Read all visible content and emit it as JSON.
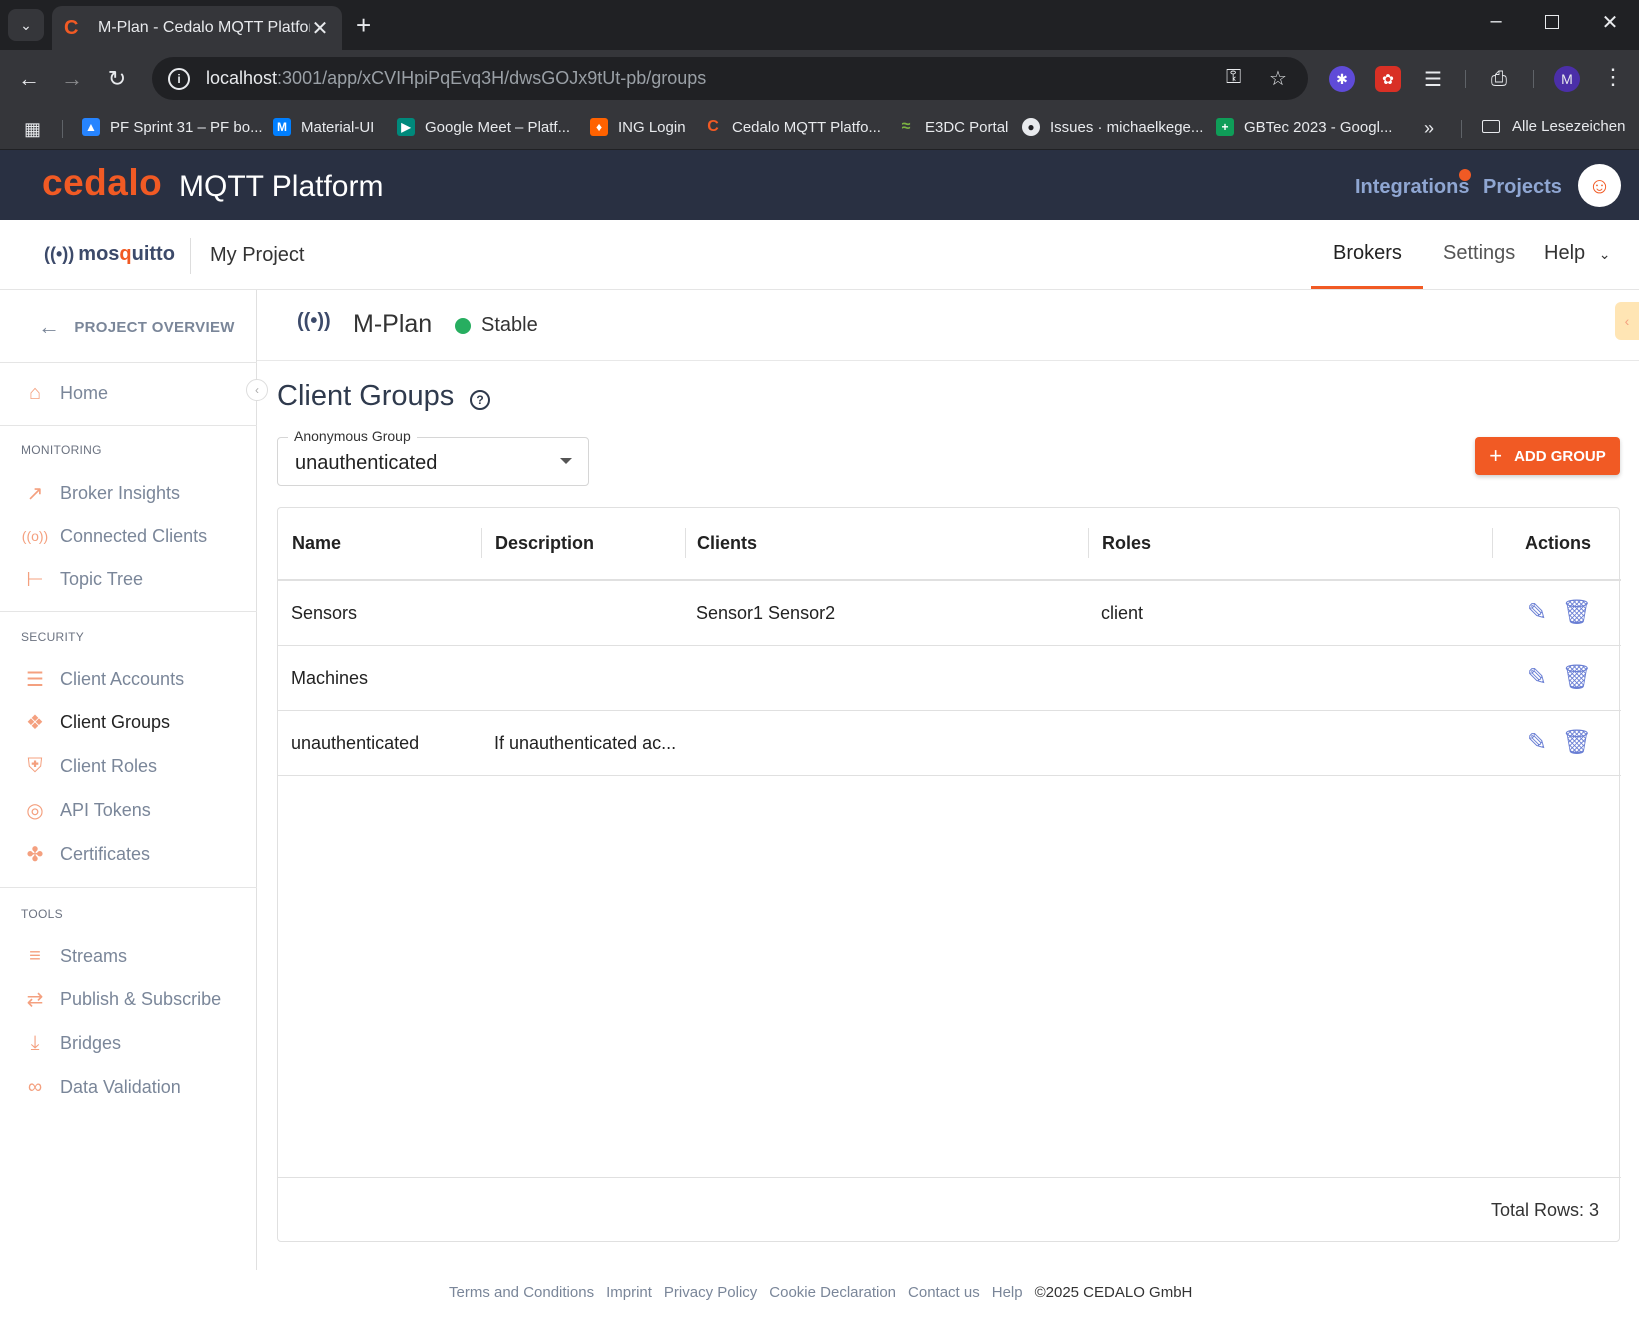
{
  "browser": {
    "tab_title": "M-Plan - Cedalo MQTT Platform",
    "url_host": "localhost",
    "url_rest": ":3001/app/xCVIHpiPqEvq3H/dwsGOJx9tUt-pb/groups",
    "bookmarks": [
      {
        "label": "PF Sprint 31 – PF bo...",
        "color": "#2684ff"
      },
      {
        "label": "Material-UI",
        "color": "#007fff"
      },
      {
        "label": "Google Meet – Platf...",
        "color": "#00897b"
      },
      {
        "label": "ING Login",
        "color": "#ff6200"
      },
      {
        "label": "Cedalo MQTT Platfo...",
        "color": "#f15a24"
      },
      {
        "label": "E3DC Portal",
        "color": "#7cb342"
      },
      {
        "label": "Issues · michaelkege...",
        "color": "#202124"
      },
      {
        "label": "GBTec 2023 - Googl...",
        "color": "#0f9d58"
      }
    ],
    "all_bookmarks": "Alle Lesezeichen",
    "profile_initial": "M"
  },
  "header": {
    "brand": "cedalo",
    "product": "MQTT Platform",
    "integrations": "Integrations",
    "projects": "Projects"
  },
  "subheader": {
    "logo_text_a": "mos",
    "logo_text_b": "q",
    "logo_text_c": "uitto",
    "project": "My Project",
    "tabs": [
      "Brokers",
      "Settings",
      "Help"
    ]
  },
  "sidebar": {
    "project_overview": "PROJECT OVERVIEW",
    "home": "Home",
    "sections": {
      "monitoring": "MONITORING",
      "security": "SECURITY",
      "tools": "TOOLS"
    },
    "monitoring": [
      "Broker Insights",
      "Connected Clients",
      "Topic Tree"
    ],
    "security": [
      "Client Accounts",
      "Client Groups",
      "Client Roles",
      "API Tokens",
      "Certificates"
    ],
    "tools": [
      "Streams",
      "Publish & Subscribe",
      "Bridges",
      "Data Validation"
    ]
  },
  "broker": {
    "name": "M-Plan",
    "status": "Stable",
    "status_color": "#27ae60"
  },
  "main": {
    "title": "Client Groups",
    "anonymous_label": "Anonymous Group",
    "anonymous_value": "unauthenticated",
    "add_button": "ADD GROUP",
    "columns": [
      "Name",
      "Description",
      "Clients",
      "Roles",
      "Actions"
    ],
    "rows": [
      {
        "name": "Sensors",
        "description": "",
        "clients": "Sensor1 Sensor2",
        "roles": "client"
      },
      {
        "name": "Machines",
        "description": "",
        "clients": "",
        "roles": ""
      },
      {
        "name": "unauthenticated",
        "description": "If unauthenticated ac...",
        "clients": "",
        "roles": ""
      }
    ],
    "total_rows": "Total Rows: 3"
  },
  "footer": {
    "links": [
      "Terms and Conditions",
      "Imprint",
      "Privacy Policy",
      "Cookie Declaration",
      "Contact us",
      "Help"
    ],
    "copyright": "©2025 CEDALO GmbH"
  },
  "colors": {
    "accent": "#f15a24",
    "header_bg": "#293042",
    "icon_blue": "#6a7fd4"
  }
}
